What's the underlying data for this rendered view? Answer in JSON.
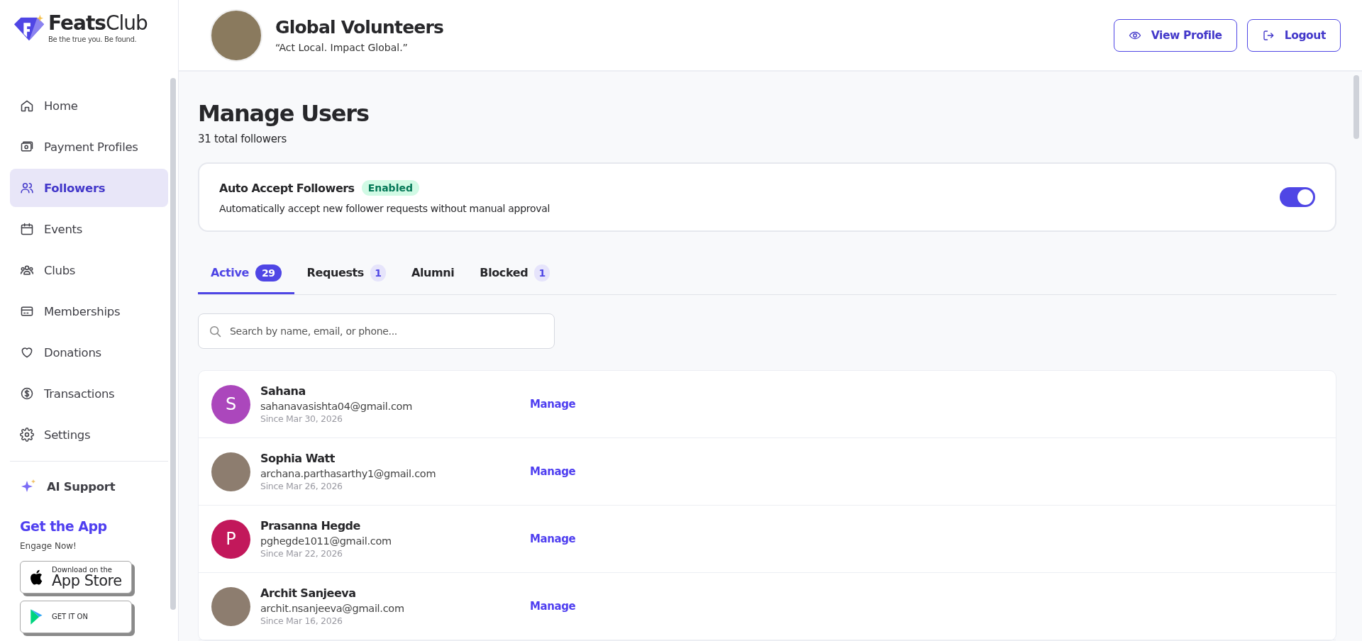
{
  "brand": {
    "name_bold": "Feats",
    "name_light": "Club",
    "tagline": "Be the true you. Be found."
  },
  "sidebar": {
    "items": [
      {
        "label": "Home",
        "kind": "home",
        "selected": false
      },
      {
        "label": "Payment Profiles",
        "kind": "wallet",
        "selected": false
      },
      {
        "label": "Followers",
        "kind": "users",
        "selected": true
      },
      {
        "label": "Events",
        "kind": "calendar",
        "selected": false
      },
      {
        "label": "Clubs",
        "kind": "group",
        "selected": false
      },
      {
        "label": "Memberships",
        "kind": "card",
        "selected": false
      },
      {
        "label": "Donations",
        "kind": "heart",
        "selected": false
      },
      {
        "label": "Transactions",
        "kind": "dollar",
        "selected": false
      },
      {
        "label": "Settings",
        "kind": "gear",
        "selected": false
      }
    ],
    "support": {
      "label": "AI Support"
    },
    "app_promo": {
      "title": "Get the App",
      "subtitle": "Engage Now!",
      "badges": [
        {
          "kind": "apple",
          "small": "Download on the",
          "big": "App Store"
        },
        {
          "kind": "google",
          "small": "GET IT ON"
        }
      ]
    }
  },
  "header": {
    "org_name": "Global Volunteers",
    "motto": "“Act Local. Impact Global.”",
    "buttons": [
      {
        "label": "View Profile",
        "kind": "eye"
      },
      {
        "label": "Logout",
        "kind": "logout"
      }
    ]
  },
  "page": {
    "title": "Manage Users",
    "subtitle": "31 total followers"
  },
  "auto_accept": {
    "title": "Auto Accept Followers",
    "status": "Enabled",
    "description": "Automatically accept new follower requests without manual approval",
    "on": true
  },
  "tabs": [
    {
      "label": "Active",
      "count": "29",
      "selected": true
    },
    {
      "label": "Requests",
      "count": "1",
      "selected": false
    },
    {
      "label": "Alumni",
      "selected": false
    },
    {
      "label": "Blocked",
      "count": "1",
      "selected": false
    }
  ],
  "search": {
    "placeholder": "Search by name, email, or phone..."
  },
  "users": [
    {
      "name": "Sahana",
      "email": "sahanavasishta04@gmail.com",
      "since": "Since Mar 30, 2026",
      "avatar": {
        "kind": "letter",
        "letter": "S",
        "color": "#ab47bc"
      },
      "action": "Manage"
    },
    {
      "name": "Sophia Watt",
      "email": "archana.parthasarthy1@gmail.com",
      "since": "Since Mar 26, 2026",
      "avatar": {
        "kind": "photo"
      },
      "action": "Manage"
    },
    {
      "name": "Prasanna Hegde",
      "email": "pghegde1011@gmail.com",
      "since": "Since Mar 22, 2026",
      "avatar": {
        "kind": "letter",
        "letter": "P",
        "color": "#c2185b"
      },
      "action": "Manage"
    },
    {
      "name": "Archit Sanjeeva",
      "email": "archit.nsanjeeva@gmail.com",
      "since": "Since Mar 16, 2026",
      "avatar": {
        "kind": "photo"
      },
      "action": "Manage"
    }
  ]
}
